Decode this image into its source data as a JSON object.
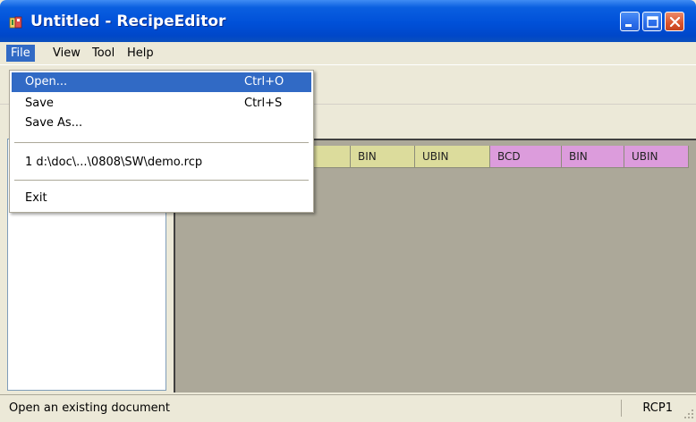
{
  "window": {
    "title": "Untitled - RecipeEditor"
  },
  "menubar": {
    "items": [
      {
        "label": "File"
      },
      {
        "label": "View"
      },
      {
        "label": "Tool"
      },
      {
        "label": "Help"
      }
    ]
  },
  "file_menu": {
    "open": {
      "label": "Open...",
      "shortcut": "Ctrl+O"
    },
    "save": {
      "label": "Save",
      "shortcut": "Ctrl+S"
    },
    "save_as": {
      "label": "Save As..."
    },
    "recent": {
      "label": "1 d:\\doc\\...\\0808\\SW\\demo.rcp"
    },
    "exit": {
      "label": "Exit"
    }
  },
  "grid": {
    "columns": [
      {
        "label": "",
        "color": "#dcdc9c"
      },
      {
        "label": "BIN",
        "color": "#dcdc9c"
      },
      {
        "label": "UBIN",
        "color": "#dcdc9c"
      },
      {
        "label": "BCD",
        "color": "#dc9cdc"
      },
      {
        "label": "BIN",
        "color": "#dc9cdc"
      },
      {
        "label": "UBIN",
        "color": "#dc9cdc"
      }
    ]
  },
  "statusbar": {
    "message": "Open an existing document",
    "panel": "RCP1"
  },
  "colors": {
    "titlebar": "#0050d8",
    "menu_highlight": "#316ac5",
    "grid_background": "#aca899"
  }
}
